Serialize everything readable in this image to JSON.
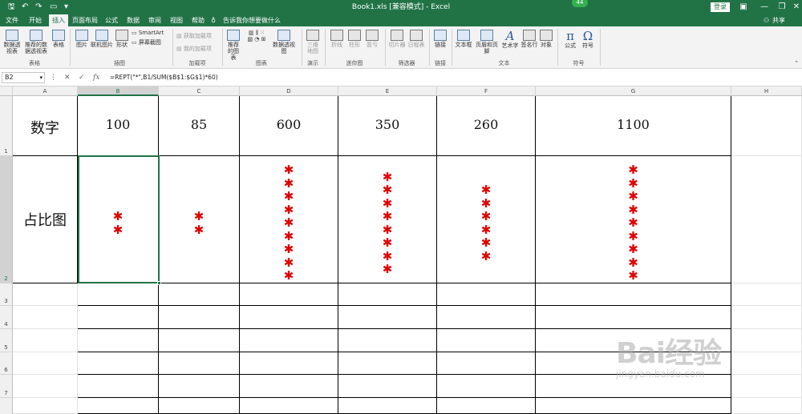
{
  "titlebar": {
    "title": "Book1.xls  [兼容模式]  -  Excel",
    "badge": "44",
    "login": "登录"
  },
  "tabs": [
    "文件",
    "开始",
    "插入",
    "页面布局",
    "公式",
    "数据",
    "审阅",
    "视图",
    "帮助"
  ],
  "active_tab": "插入",
  "search_text": "告诉我你想要做什么",
  "share_text": "共享",
  "ribbon": {
    "buttons": {
      "pivot": "数据透视表",
      "rec_pivot": "推荐的数据透视表",
      "table": "表格",
      "picture": "图片",
      "online_picture": "联机图片",
      "shapes": "形状",
      "smartart": "SmartArt",
      "screenshot": "屏幕截图",
      "get_addins": "获取加载项",
      "my_addins": "我的加载项",
      "rec_charts": "推荐的图表",
      "pivot_chart": "数据透视图",
      "map3d": "三维地图",
      "line": "折线",
      "column": "柱形",
      "winloss": "盈亏",
      "slicer": "切片器",
      "timeline": "日程表",
      "link": "链接",
      "textbox": "文本框",
      "header_footer": "页眉和页脚",
      "wordart": "艺术字",
      "signature": "签名行",
      "object": "对象",
      "equation": "公式",
      "symbol": "符号"
    },
    "groups": {
      "tables": "表格",
      "illustrations": "插图",
      "addins": "加载项",
      "charts": "图表",
      "tours": "演示",
      "sparklines": "迷你图",
      "filters": "筛选器",
      "links": "链接",
      "text": "文本",
      "symbols": "符号"
    }
  },
  "formula_bar": {
    "name_box": "B2",
    "fx": "fx",
    "formula": "=REPT(\"*\",B1/SUM($B$1:$G$1)*60)"
  },
  "columns": [
    "A",
    "B",
    "C",
    "D",
    "E",
    "F",
    "G",
    "H"
  ],
  "selected_column": "B",
  "rows": [
    "1",
    "2",
    "3",
    "4",
    "5",
    "6",
    "7"
  ],
  "selected_row": "2",
  "sheet": {
    "row1_label": "数字",
    "row2_label": "占比图",
    "values": [
      100,
      85,
      600,
      350,
      260,
      1100
    ],
    "star_counts": [
      2,
      2,
      9,
      8,
      6,
      9
    ],
    "star_char": "✱",
    "star_color": "#e00000"
  },
  "watermark": {
    "main": "Bai经验",
    "sub": "jingyan.baidu.com"
  }
}
